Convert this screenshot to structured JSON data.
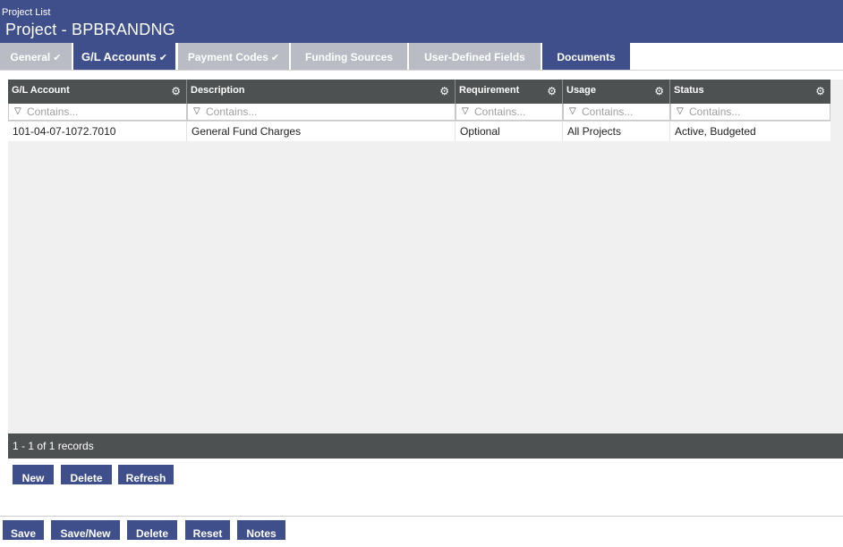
{
  "header": {
    "breadcrumb": "Project List",
    "title": "Project - BPBRANDNG"
  },
  "tabs": [
    {
      "label": "General",
      "check": "✔"
    },
    {
      "label": "G/L Accounts",
      "check": "✔"
    },
    {
      "label": "Payment Codes",
      "check": "✔"
    },
    {
      "label": "Funding Sources"
    },
    {
      "label": "User-Defined Fields"
    },
    {
      "label": "Documents"
    }
  ],
  "active_tab": "G/L Accounts",
  "grid": {
    "columns": [
      {
        "label": "G/L Account",
        "filter_placeholder": "Contains..."
      },
      {
        "label": "Description",
        "filter_placeholder": "Contains..."
      },
      {
        "label": "Requirement",
        "filter_placeholder": "Contains..."
      },
      {
        "label": "Usage",
        "filter_placeholder": "Contains..."
      },
      {
        "label": "Status",
        "filter_placeholder": "Contains..."
      }
    ],
    "rows": [
      [
        "101-04-07-1072.7010",
        "General Fund Charges",
        "Optional",
        "All Projects",
        "Active, Budgeted"
      ]
    ],
    "footer": "1 - 1 of 1 records"
  },
  "grid_buttons": {
    "new": "New",
    "delete": "Delete",
    "refresh": "Refresh"
  },
  "form_buttons": {
    "save": "Save",
    "save_new": "Save/New",
    "delete": "Delete",
    "reset": "Reset",
    "notes": "Notes"
  },
  "colors": {
    "brand": "#3f4f8c",
    "tab_inactive": "#b9bcc4",
    "grid_header": "#4d5152",
    "grid_body": "#f0f0f0"
  },
  "icons": {
    "column_menu": "gear-icon",
    "filter": "funnel-icon",
    "tab_complete": "checkmark-icon"
  }
}
